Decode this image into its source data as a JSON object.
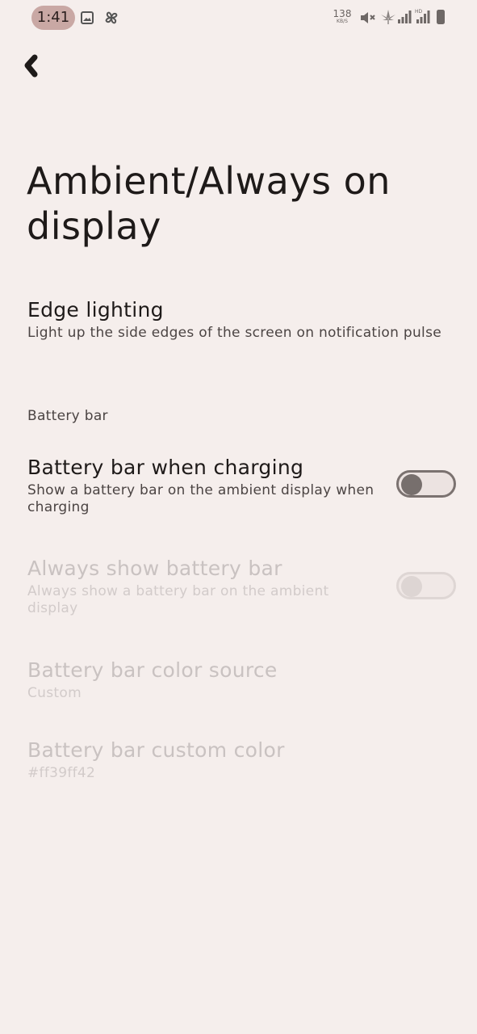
{
  "status_bar": {
    "time": "1:41",
    "net_speed_value": "138",
    "net_speed_unit": "KB/S",
    "icons": [
      "gallery-icon",
      "pinwheel-icon",
      "mute-icon",
      "cannabis-leaf-icon",
      "signal-icon",
      "signal-hd-icon",
      "battery-icon"
    ]
  },
  "header": {
    "back_icon": "chevron-left-icon",
    "title": "Ambient/Always on display"
  },
  "preferences": {
    "edge_lighting": {
      "title": "Edge lighting",
      "summary": "Light up the side edges of the screen on notification pulse"
    },
    "category_battery": "Battery bar",
    "battery_bar_charging": {
      "title": "Battery bar when charging",
      "summary": "Show a battery bar on the ambient display when charging",
      "enabled": true,
      "checked": false
    },
    "always_show_battery": {
      "title": "Always show battery bar",
      "summary": "Always show a battery bar on the ambient display",
      "enabled": false,
      "checked": false
    },
    "color_source": {
      "title": "Battery bar color source",
      "summary": "Custom",
      "enabled": false
    },
    "custom_color": {
      "title": "Battery bar custom color",
      "summary": "#ff39ff42",
      "enabled": false
    }
  },
  "colors": {
    "background": "#f5eeec",
    "clock_pill": "#c9a8a4",
    "switch_thumb": "#776f6d"
  }
}
